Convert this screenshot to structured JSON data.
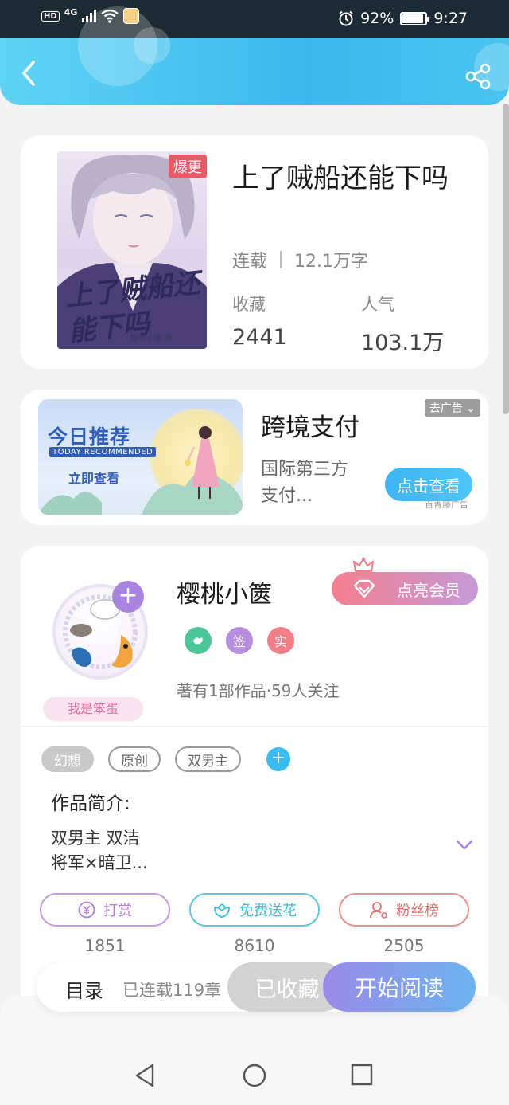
{
  "status_bar": {
    "hd": "HD",
    "network": "4G",
    "battery_percent": "92%",
    "battery_level": 0.92,
    "time": "9:27"
  },
  "book": {
    "cover_badge": "爆更",
    "cover_title": "上了贼船还能下吗",
    "cover_author": "樱桃小篋 著",
    "title": "上了贼船还能下吗",
    "status": "连载",
    "word_count": "12.1万字",
    "stats": [
      {
        "label": "收藏",
        "value": "2441"
      },
      {
        "label": "人气",
        "value": "103.1万"
      }
    ]
  },
  "ad": {
    "image_title": "今日推荐",
    "image_subtitle": "TODAY RECOMMENDED",
    "image_cta": "立即查看",
    "title": "跨境支付",
    "description": "国际第三方支付...",
    "close_label": "去广告",
    "button_label": "点击查看",
    "source": "百青藤广告"
  },
  "author": {
    "avatar_tag": "我是笨蛋",
    "name": "樱桃小篋",
    "vip_label": "点亮会员",
    "badges": [
      {
        "icon": "verified-icon",
        "text": "",
        "color": "#4cc79a"
      },
      {
        "icon": "signed-icon",
        "text": "签",
        "color": "#b88ee0"
      },
      {
        "icon": "realname-icon",
        "text": "实",
        "color": "#f07f88"
      }
    ],
    "stats_text": "著有1部作品·59人关注"
  },
  "tags": [
    {
      "label": "幻想",
      "filled": true
    },
    {
      "label": "原创",
      "filled": false
    },
    {
      "label": "双男主",
      "filled": false
    }
  ],
  "intro": {
    "title": "作品简介:",
    "line1": "双男主 双洁",
    "line2": "将军×暗卫..."
  },
  "actions": [
    {
      "label": "打赏",
      "count": "1851",
      "icon": "yen-icon",
      "color": "#b07fd8"
    },
    {
      "label": "免费送花",
      "count": "8610",
      "icon": "flower-icon",
      "color": "#3bbfd8"
    },
    {
      "label": "粉丝榜",
      "count": "2505",
      "icon": "fans-icon",
      "color": "#e4706e"
    }
  ],
  "read_bar": {
    "toc_label": "目录",
    "serial_label": "已连载119章",
    "collected_label": "已收藏",
    "read_label": "开始阅读"
  },
  "colors": {
    "header": "#3db8ee",
    "accent_purple": "#a884e0",
    "accent_blue": "#3bbcf0"
  }
}
